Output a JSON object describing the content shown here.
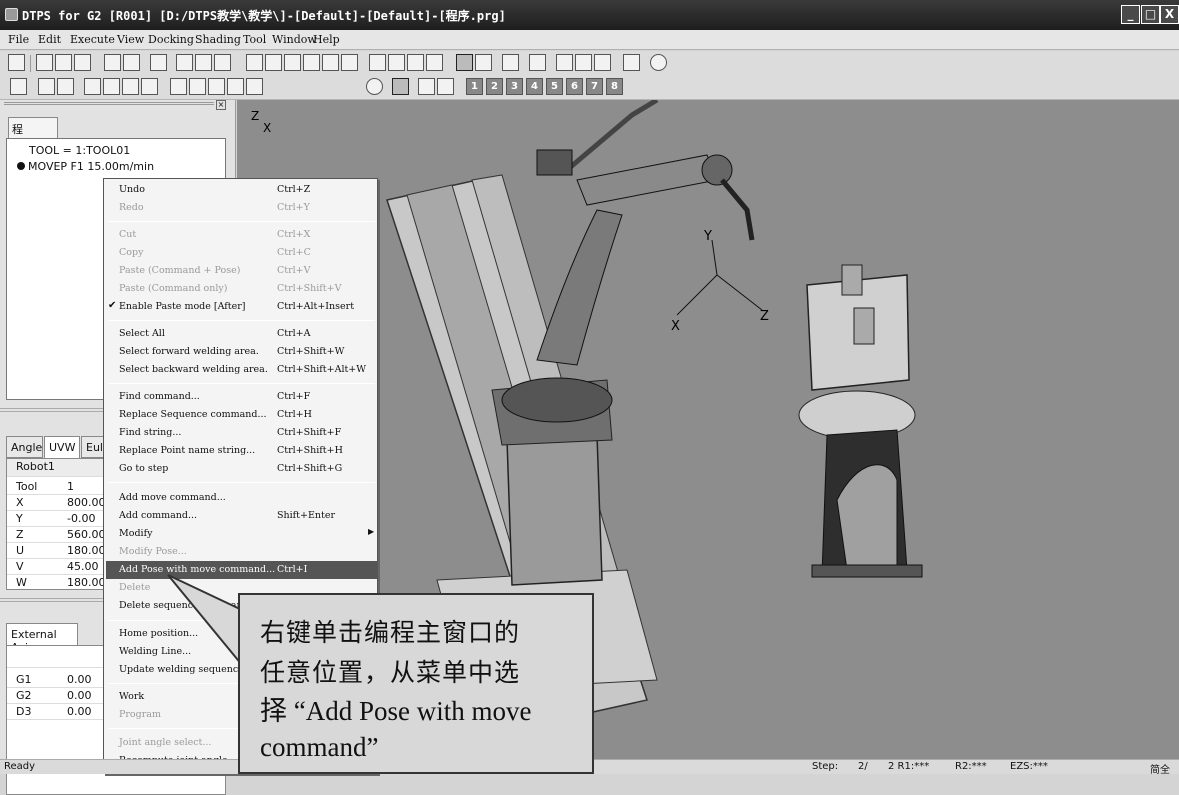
{
  "window": {
    "title": "DTPS for G2 [R001] [D:/DTPS教学\\教学\\]-[Default]-[Default]-[程序.prg]",
    "buttons": [
      "_",
      "□",
      "X"
    ]
  },
  "menubar": [
    "File",
    "Edit",
    "Execute",
    "View",
    "Docking",
    "Shading",
    "Tool",
    "Window",
    "Help"
  ],
  "left_panel": {
    "doc_tab": "程序.prg",
    "code": [
      {
        "text": "TOOL = 1:TOOL01"
      },
      {
        "text": "MOVEP F1 15.00m/min"
      }
    ],
    "pose_tabs": [
      "Angle",
      "UVW",
      "Eul"
    ],
    "pose_header": "Robot1",
    "pose_rows": [
      {
        "k": "Tool",
        "v": "1"
      },
      {
        "k": "X",
        "v": "800.00"
      },
      {
        "k": "Y",
        "v": "-0.00"
      },
      {
        "k": "Z",
        "v": "560.00"
      },
      {
        "k": "U",
        "v": "180.00"
      },
      {
        "k": "V",
        "v": "45.00"
      },
      {
        "k": "W",
        "v": "180.00"
      }
    ],
    "ext_tab": "External Axis",
    "ext_rows": [
      {
        "k": "G1",
        "v": "0.00"
      },
      {
        "k": "G2",
        "v": "0.00"
      },
      {
        "k": "D3",
        "v": "0.00"
      }
    ]
  },
  "context_menu": {
    "items": [
      {
        "label": "Undo",
        "shortcut": "Ctrl+Z",
        "disabled": false
      },
      {
        "label": "Redo",
        "shortcut": "Ctrl+Y",
        "disabled": true
      },
      {
        "sep": true
      },
      {
        "label": "Cut",
        "shortcut": "Ctrl+X",
        "disabled": true
      },
      {
        "label": "Copy",
        "shortcut": "Ctrl+C",
        "disabled": true
      },
      {
        "label": "Paste (Command + Pose)",
        "shortcut": "Ctrl+V",
        "disabled": true
      },
      {
        "label": "Paste (Command only)",
        "shortcut": "Ctrl+Shift+V",
        "disabled": true
      },
      {
        "label": "Enable Paste mode [After]",
        "shortcut": "Ctrl+Alt+Insert",
        "disabled": false,
        "checked": true
      },
      {
        "sep": true
      },
      {
        "label": "Select All",
        "shortcut": "Ctrl+A",
        "disabled": false
      },
      {
        "label": "Select forward welding area.",
        "shortcut": "Ctrl+Shift+W",
        "disabled": false
      },
      {
        "label": "Select backward welding area.",
        "shortcut": "Ctrl+Shift+Alt+W",
        "disabled": false
      },
      {
        "sep": true
      },
      {
        "label": "Find command...",
        "shortcut": "Ctrl+F",
        "disabled": false
      },
      {
        "label": "Replace Sequence command...",
        "shortcut": "Ctrl+H",
        "disabled": false
      },
      {
        "label": "Find string...",
        "shortcut": "Ctrl+Shift+F",
        "disabled": false
      },
      {
        "label": "Replace Point name string...",
        "shortcut": "Ctrl+Shift+H",
        "disabled": false
      },
      {
        "label": "Go to step",
        "shortcut": "Ctrl+Shift+G",
        "disabled": false
      },
      {
        "sep": true
      },
      {
        "label": "Add move command...",
        "shortcut": "",
        "disabled": false
      },
      {
        "label": "Add command...",
        "shortcut": "Shift+Enter",
        "disabled": false
      },
      {
        "label": "Modify",
        "shortcut": "",
        "disabled": false,
        "submenu": true
      },
      {
        "label": "Modify Pose...",
        "shortcut": "",
        "disabled": true
      },
      {
        "label": "Add Pose with move command...",
        "shortcut": "Ctrl+I",
        "disabled": false,
        "highlighted": true
      },
      {
        "label": "Delete",
        "shortcut": "",
        "disabled": true
      },
      {
        "label": "Delete sequence command",
        "shortcut": "",
        "disabled": false
      },
      {
        "sep": true
      },
      {
        "label": "Home position...",
        "shortcut": "",
        "disabled": false
      },
      {
        "label": "Welding Line...",
        "shortcut": "",
        "disabled": false
      },
      {
        "label": "Update welding sequence",
        "shortcut": "",
        "disabled": false
      },
      {
        "sep": true
      },
      {
        "label": "Work",
        "shortcut": "",
        "disabled": false
      },
      {
        "label": "Program",
        "shortcut": "",
        "disabled": true
      },
      {
        "sep": true
      },
      {
        "label": "Joint angle select...",
        "shortcut": "",
        "disabled": true
      },
      {
        "label": "Recompute joint angle",
        "shortcut": "",
        "disabled": false
      }
    ]
  },
  "callout": {
    "zh_line1": "右键单击编程主窗口的",
    "zh_line2": "任意位置，从菜单中选",
    "line3": "择 “Add Pose with move",
    "line4": " command”"
  },
  "viewport_labels": {
    "corner_axis_z": "Z",
    "corner_axis_x": "X",
    "tool_y": "Y",
    "tool_z": "Z",
    "tool_x": "X"
  },
  "statusbar": {
    "ready": "Ready",
    "step_label": "Step:",
    "step_value": "2/",
    "r1": "2 R1:***",
    "r2": "R2:***",
    "ezs": "EZS:***",
    "tray": "简全"
  },
  "toolbar_numbers": [
    "1",
    "2",
    "3",
    "4",
    "5",
    "6",
    "7",
    "8"
  ],
  "colors": {
    "titlebar": "#2a2a2a",
    "highlight": "#555555",
    "viewport": "#8d8d8d"
  }
}
